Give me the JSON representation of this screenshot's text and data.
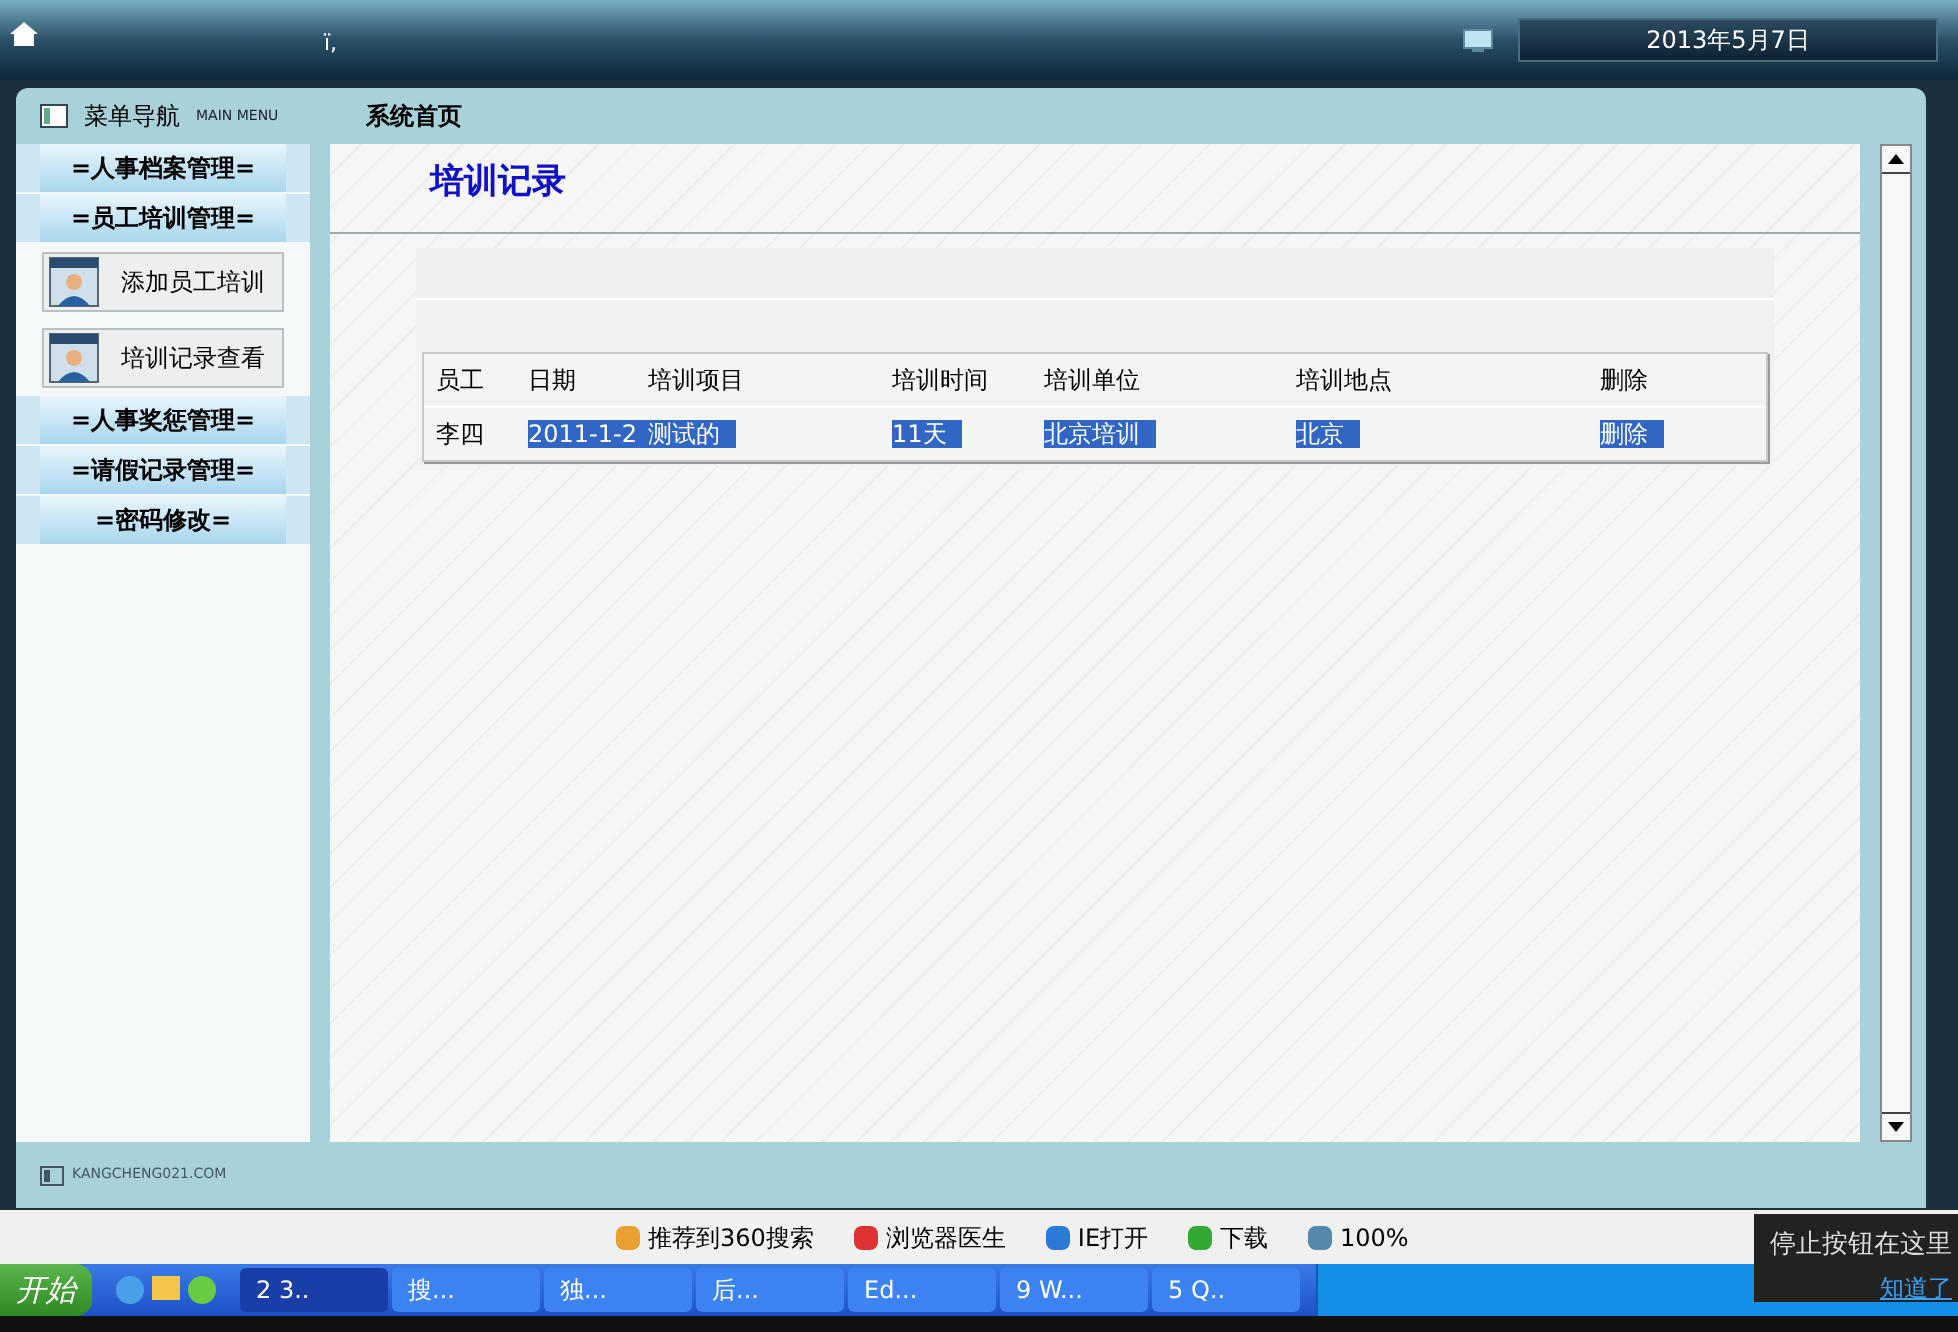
{
  "top_bar": {
    "marquee": "ï,",
    "date": "2013年5月7日"
  },
  "sidebar": {
    "title": "菜单导航",
    "subtitle": "MAIN MENU",
    "items": [
      {
        "kind": "group",
        "label": "=人事档案管理="
      },
      {
        "kind": "group",
        "label": "=员工培训管理="
      },
      {
        "kind": "link",
        "label": "添加员工培训"
      },
      {
        "kind": "link",
        "label": "培训记录查看"
      },
      {
        "kind": "group",
        "label": "=人事奖惩管理="
      },
      {
        "kind": "group",
        "label": "=请假记录管理="
      },
      {
        "kind": "group",
        "label": "=密码修改="
      }
    ],
    "footer": "KANGCHENG021.COM"
  },
  "breadcrumb": "系统首页",
  "page_title": "培训记录",
  "table": {
    "columns": [
      "员工",
      "日期",
      "培训项目",
      "培训时间",
      "培训单位",
      "培训地点",
      "删除"
    ],
    "rows": [
      [
        {
          "text": "李四",
          "highlighted": false
        },
        {
          "text": "2011-1-2",
          "highlighted": true
        },
        {
          "text": "测试的",
          "highlighted": true
        },
        {
          "text": "11天",
          "highlighted": true
        },
        {
          "text": "北京培训",
          "highlighted": true
        },
        {
          "text": "北京",
          "highlighted": true
        },
        {
          "text": "删除",
          "highlighted": true
        }
      ]
    ]
  },
  "browser_status": [
    "推荐到360搜索",
    "浏览器医生",
    "IE打开",
    "下载",
    "100%"
  ],
  "taskbar": {
    "start": "开始",
    "items": [
      {
        "label": "2 3..",
        "selected": true
      },
      {
        "label": "搜...",
        "selected": false
      },
      {
        "label": "独...",
        "selected": false
      },
      {
        "label": "后...",
        "selected": false
      },
      {
        "label": "Ed...",
        "selected": false
      },
      {
        "label": "9 W...",
        "selected": false
      },
      {
        "label": "5 Q..",
        "selected": false
      }
    ]
  },
  "tooltip": {
    "text": "停止按钮在这里",
    "link": "知道了"
  }
}
